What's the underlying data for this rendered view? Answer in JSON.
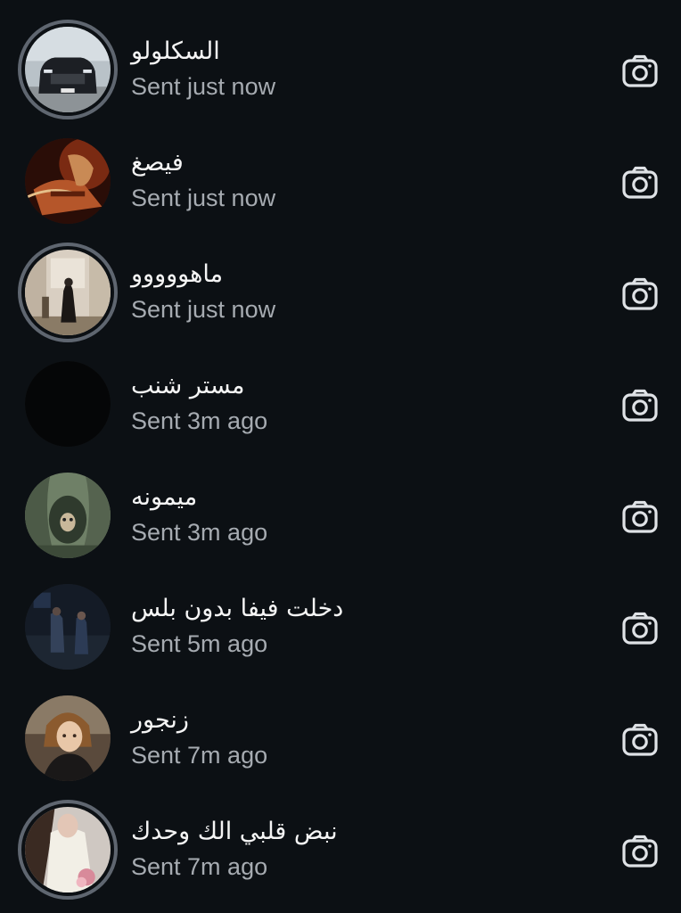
{
  "conversations": [
    {
      "name": "السكلولو",
      "status": "Sent just now",
      "has_story": true,
      "avatar": "car-photo"
    },
    {
      "name": "فيصغ",
      "status": "Sent just now",
      "has_story": false,
      "avatar": "guitarist-photo"
    },
    {
      "name": "ماهووووو",
      "status": "Sent just now",
      "has_story": true,
      "avatar": "room-photo"
    },
    {
      "name": "مستر شنب",
      "status": "Sent 3m ago",
      "has_story": false,
      "avatar": "black-photo"
    },
    {
      "name": "ميمونه",
      "status": "Sent 3m ago",
      "has_story": false,
      "avatar": "tree-owl-photo"
    },
    {
      "name": "دخلت فيفا بدون بلس",
      "status": "Sent 5m ago",
      "has_story": false,
      "avatar": "night-scene-photo"
    },
    {
      "name": "زنجور",
      "status": "Sent 7m ago",
      "has_story": false,
      "avatar": "anime-girl-photo"
    },
    {
      "name": "نبض قلبي الك وحدك",
      "status": "Sent 7m ago",
      "has_story": true,
      "avatar": "white-dress-photo"
    }
  ],
  "colors": {
    "background": "#0c1014",
    "name_text": "#f5f5f5",
    "status_text": "#a6abb1",
    "story_ring": "#5f6670",
    "camera_icon": "#dfe2e6"
  },
  "icons": {
    "action": "camera-icon"
  }
}
